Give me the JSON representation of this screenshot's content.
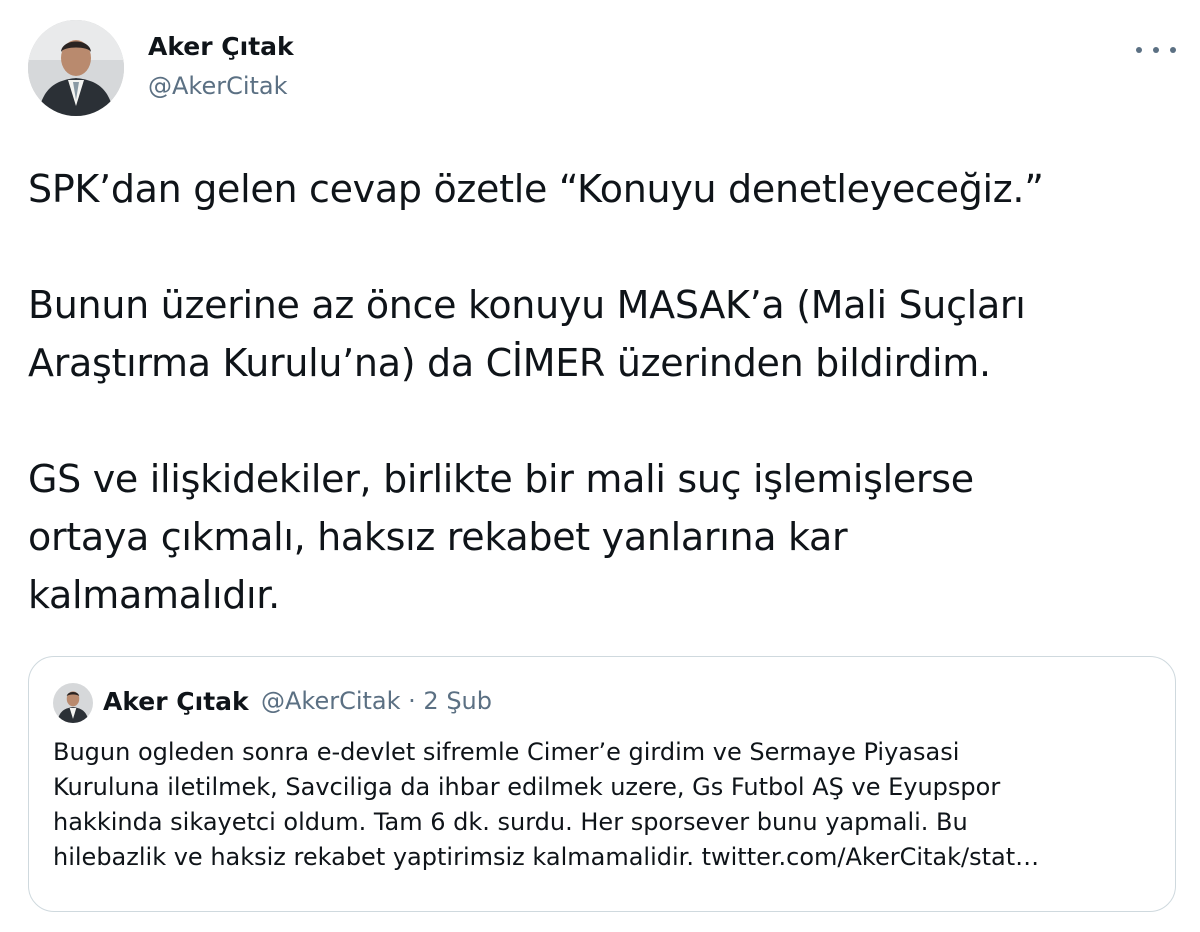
{
  "author": {
    "display_name": "Aker Çıtak",
    "handle": "@AkerCitak"
  },
  "tweet": {
    "paragraphs": [
      [
        "SPK’dan gelen cevap özetle “Konuyu denetleyeceğiz.”"
      ],
      [
        "Bunun üzerine az önce konuyu MASAK’a (Mali Suçları",
        "Araştırma Kurulu’na) da CİMER üzerinden bildirdim."
      ],
      [
        "GS ve ilişkidekiler, birlikte bir mali suç işlemişlerse",
        "ortaya çıkmalı, haksız rekabet yanlarına kar",
        "kalmamalıdır."
      ]
    ]
  },
  "quoted_tweet": {
    "display_name": "Aker Çıtak",
    "meta": "@AkerCitak · 2 Şub",
    "lines": [
      "Bugun ogleden sonra e-devlet sifremle Cimer’e girdim ve Sermaye Piyasasi",
      "Kuruluna iletilmek, Savciliga da ihbar edilmek uzere, Gs Futbol AŞ ve Eyupspor",
      "hakkinda sikayetci oldum. Tam 6 dk. surdu. Her sporsever bunu yapmali. Bu",
      "hilebazlik ve haksiz rekabet yaptirimsiz kalmamalidir. twitter.com/AkerCitak/stat…"
    ]
  },
  "icons": {
    "more": "more-horizontal-icon"
  },
  "colors": {
    "text": "#0f1419",
    "secondary": "#5b7083",
    "border": "#cfd9de"
  }
}
